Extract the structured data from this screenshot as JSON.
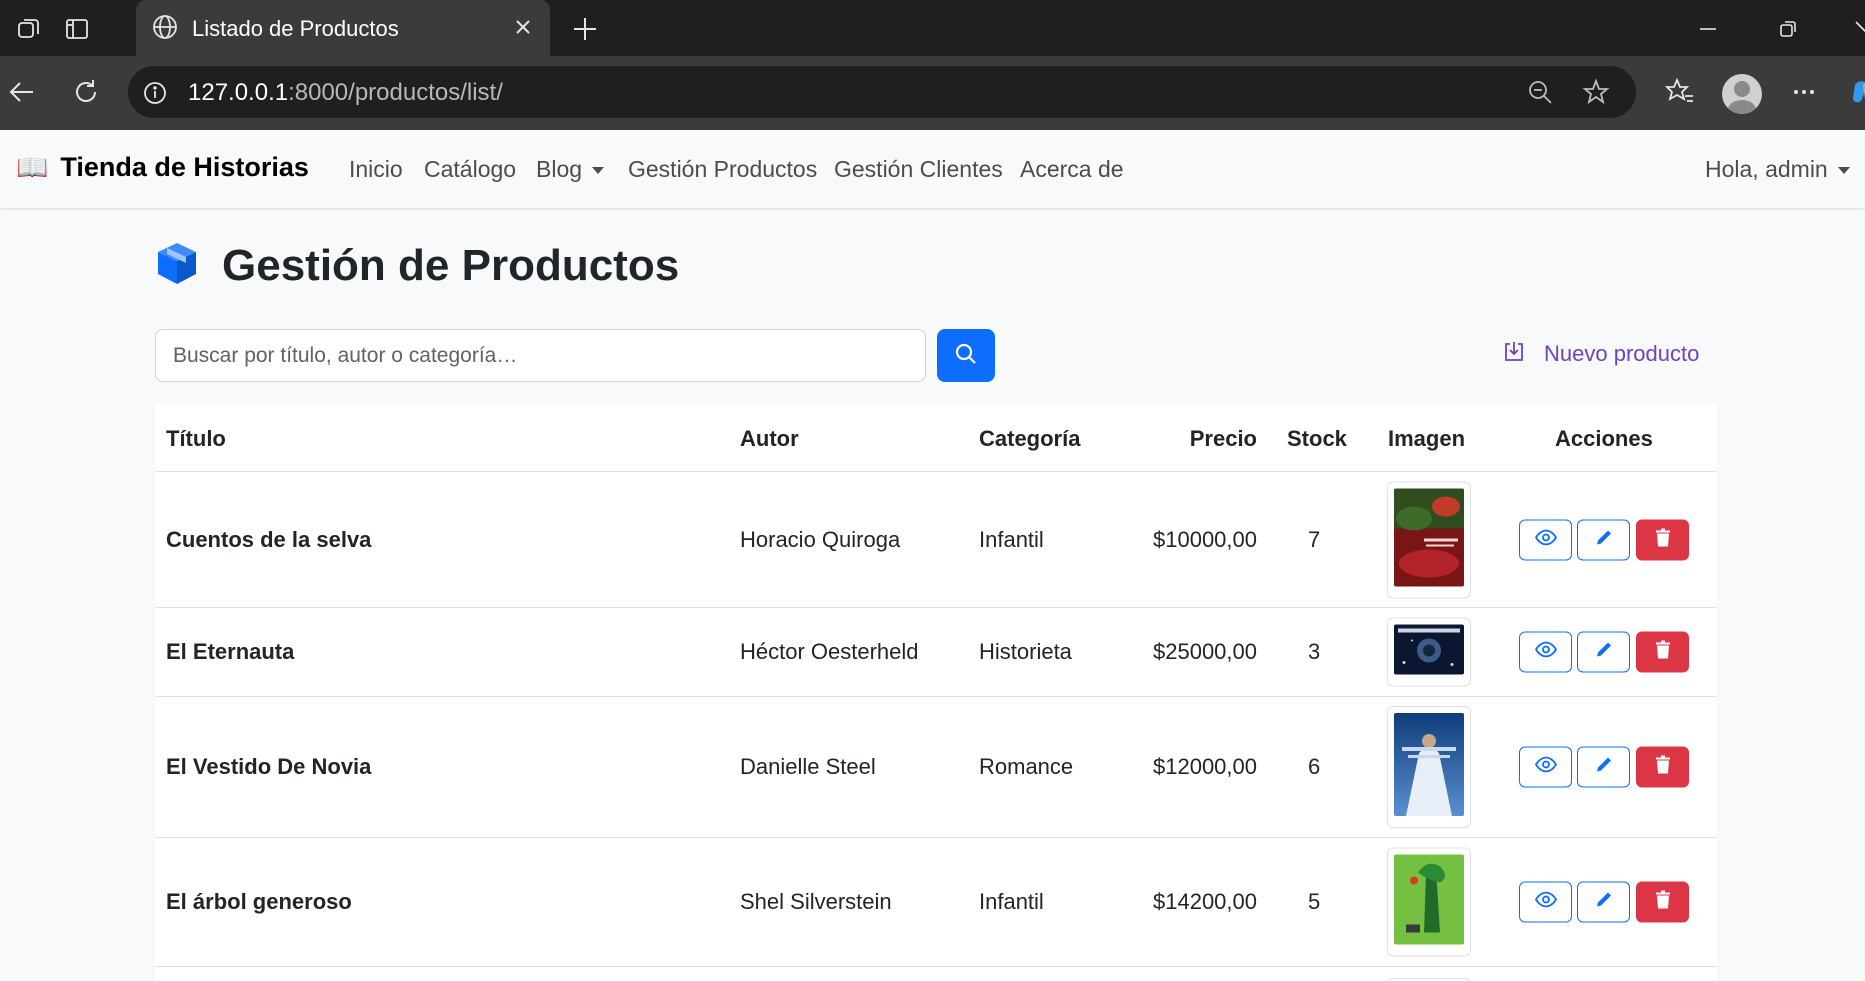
{
  "browser": {
    "tab_title": "Listado de Productos",
    "url_host": "127.0.0.1",
    "url_path": ":8000/productos/list/"
  },
  "navbar": {
    "brand_icon": "📖",
    "brand": "Tienda de Historias",
    "links": [
      "Inicio",
      "Catálogo",
      "Blog",
      "Gestión Productos",
      "Gestión Clientes",
      "Acerca de"
    ],
    "user_menu": "Hola, admin"
  },
  "page": {
    "title": "Gestión de Productos",
    "search_placeholder": "Buscar por título, autor o categoría…",
    "new_product_label": "Nuevo producto"
  },
  "table": {
    "headers": [
      "Título",
      "Autor",
      "Categoría",
      "Precio",
      "Stock",
      "Imagen",
      "Acciones"
    ],
    "rows": [
      {
        "title": "Cuentos de la selva",
        "author": "Horacio Quiroga",
        "category": "Infantil",
        "price": "$10000,00",
        "stock": "7"
      },
      {
        "title": "El Eternauta",
        "author": "Héctor Oesterheld",
        "category": "Historieta",
        "price": "$25000,00",
        "stock": "3"
      },
      {
        "title": "El Vestido De Novia",
        "author": "Danielle Steel",
        "category": "Romance",
        "price": "$12000,00",
        "stock": "6"
      },
      {
        "title": "El árbol generoso",
        "author": "Shel Silverstein",
        "category": "Infantil",
        "price": "$14200,00",
        "stock": "5"
      }
    ]
  },
  "colors": {
    "primary": "#0d6efd",
    "danger": "#dc3545",
    "link_purple": "#6f42c1"
  }
}
